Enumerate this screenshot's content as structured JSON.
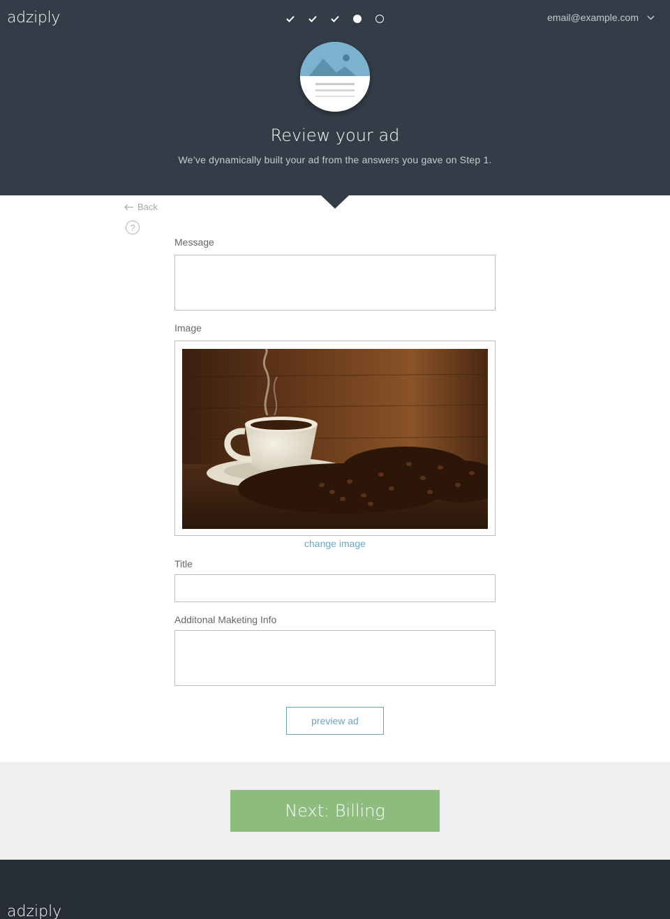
{
  "app": {
    "logo": "adziply"
  },
  "progress": {
    "steps": [
      "done",
      "done",
      "done",
      "current",
      "todo"
    ]
  },
  "account": {
    "email": "email@example.com"
  },
  "hero": {
    "title": "Review your ad",
    "subtitle": "We’ve dynamically built your ad from the answers you gave on Step 1."
  },
  "nav": {
    "back_label": "Back",
    "help_label": "?"
  },
  "form": {
    "message_label": "Message",
    "message_value": "",
    "image_label": "Image",
    "change_image_label": "change image",
    "title_label": "Title",
    "title_value": "",
    "info_label": "Additonal Maketing Info",
    "info_value": "",
    "preview_label": "preview ad"
  },
  "action": {
    "next_label": "Next: Billing"
  },
  "footer": {
    "logo": "adziply"
  },
  "colors": {
    "header_bg": "#333d48",
    "accent_blue": "#6ea3bf",
    "next_green": "#8ebc7e",
    "footer_bg": "#272d35"
  }
}
